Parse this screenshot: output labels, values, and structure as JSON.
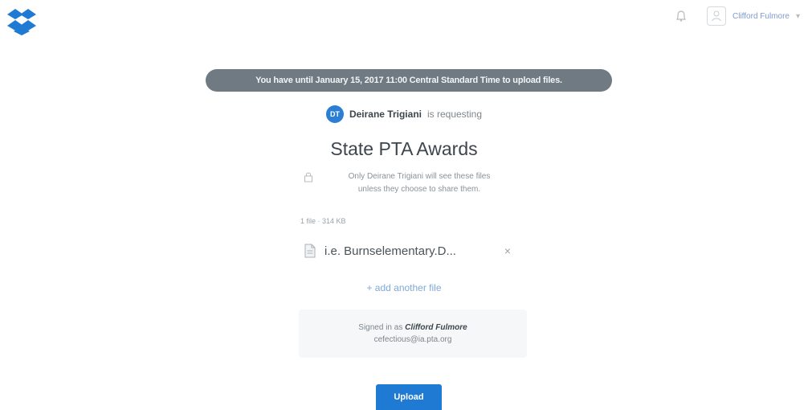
{
  "header": {
    "logo_icon": "dropbox-logo",
    "notification_icon": "bell-icon",
    "user_name": "Clifford Fulmore"
  },
  "deadline_banner": "You have until January 15, 2017 11:00 Central Standard Time to upload files.",
  "request": {
    "requester_initials": "DT",
    "requester_name": "Deirane Trigiani",
    "requesting_text": "is requesting",
    "title": "State PTA Awards",
    "privacy_line1": "Only Deirane Trigiani will see these files",
    "privacy_line2": "unless they choose to share them."
  },
  "upload": {
    "file_count": "1 file · 314 KB",
    "files": [
      {
        "name": "i.e. Burnselementary.D...",
        "remove_label": "×"
      }
    ],
    "add_link": "+ add another file"
  },
  "signed_in": {
    "prefix": "Signed in as",
    "name": "Clifford Fulmore",
    "email": "cefectious@ia.pta.org"
  },
  "upload_button": "Upload",
  "colors": {
    "brand_blue": "#1f7ad4",
    "banner_gray": "#707a82"
  }
}
